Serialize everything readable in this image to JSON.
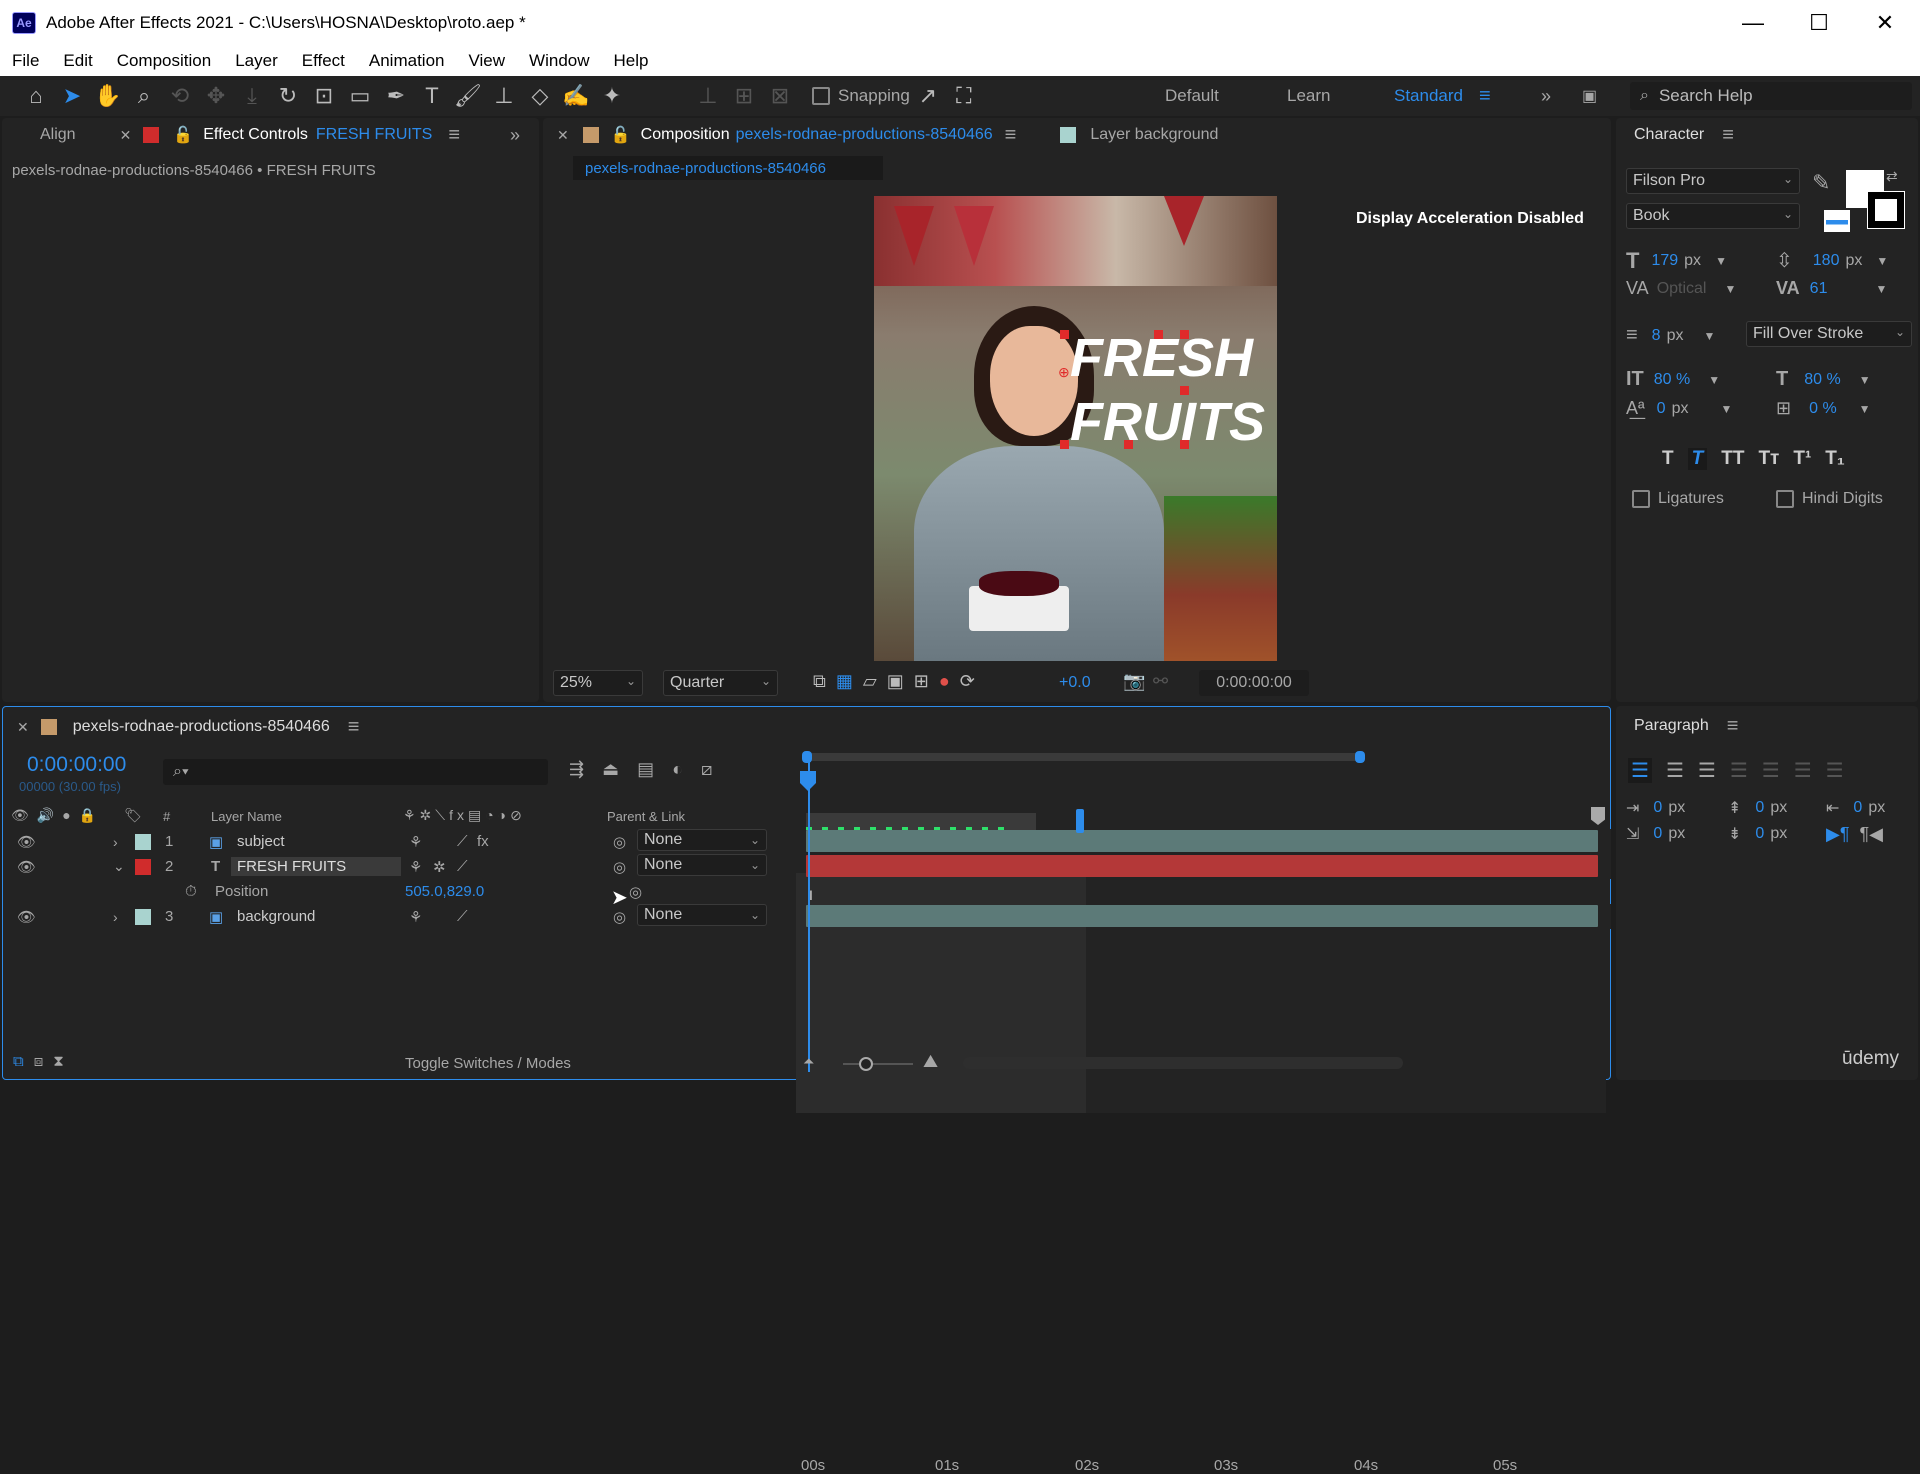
{
  "app": {
    "title": "Adobe After Effects 2021 - C:\\Users\\HOSNA\\Desktop\\roto.aep *",
    "logo": "Ae"
  },
  "window_controls": {
    "minimize": "—",
    "maximize": "☐",
    "close": "✕"
  },
  "menu": [
    "File",
    "Edit",
    "Composition",
    "Layer",
    "Effect",
    "Animation",
    "View",
    "Window",
    "Help"
  ],
  "toolbar": {
    "snapping_label": "Snapping",
    "workspaces": [
      "Default",
      "Learn",
      "Standard"
    ],
    "active_workspace": "Standard",
    "search_placeholder": "Search Help"
  },
  "left_panel": {
    "tab_align": "Align",
    "tab_effect_controls": "Effect Controls",
    "tab_effect_target": "FRESH FRUITS",
    "breadcrumb": "pexels-rodnae-productions-8540466 • FRESH FRUITS"
  },
  "comp_panel": {
    "tab_label": "Composition",
    "tab_name": "pexels-rodnae-productions-8540466",
    "layer_tab": "Layer background",
    "sub_tab": "pexels-rodnae-productions-8540466",
    "notice": "Display Acceleration Disabled",
    "overlay_line1": "FRESH",
    "overlay_line2": "FRUITS",
    "zoom": "25%",
    "resolution": "Quarter",
    "exposure": "+0.0",
    "timecode": "0:00:00:00"
  },
  "character": {
    "title": "Character",
    "font": "Filson Pro",
    "style": "Book",
    "font_size": "179",
    "leading": "180",
    "kerning": "Optical",
    "tracking": "61",
    "stroke_width": "8",
    "stroke_mode": "Fill Over Stroke",
    "vscale": "80 %",
    "hscale": "80 %",
    "baseline": "0",
    "tsume": "0 %",
    "unit_px": "px",
    "ligatures": "Ligatures",
    "hindi_digits": "Hindi Digits"
  },
  "paragraph": {
    "title": "Paragraph",
    "indent_left": "0",
    "indent_first": "0",
    "space_before": "0",
    "indent_right": "0",
    "space_after": "0",
    "unit_px": "px"
  },
  "timeline": {
    "comp_name": "pexels-rodnae-productions-8540466",
    "timecode": "0:00:00:00",
    "frame_info": "00000 (30.00 fps)",
    "col_layer_name": "Layer Name",
    "col_parent": "Parent & Link",
    "col_hash": "#",
    "ruler": [
      "00s",
      "01s",
      "02s",
      "03s",
      "04s",
      "05s"
    ],
    "layers": [
      {
        "num": "1",
        "type": "image",
        "name": "subject",
        "parent": "None",
        "label_color": "#a9d3cf"
      },
      {
        "num": "2",
        "type": "text",
        "name": "FRESH FRUITS",
        "parent": "None",
        "label_color": "#d02c2c"
      },
      {
        "num": "3",
        "type": "image",
        "name": "background",
        "parent": "None",
        "label_color": "#a9d3cf"
      }
    ],
    "position_prop": "Position",
    "position_value": "505.0,829.0",
    "toggle_label": "Toggle Switches / Modes"
  },
  "watermark": "ūdemy"
}
